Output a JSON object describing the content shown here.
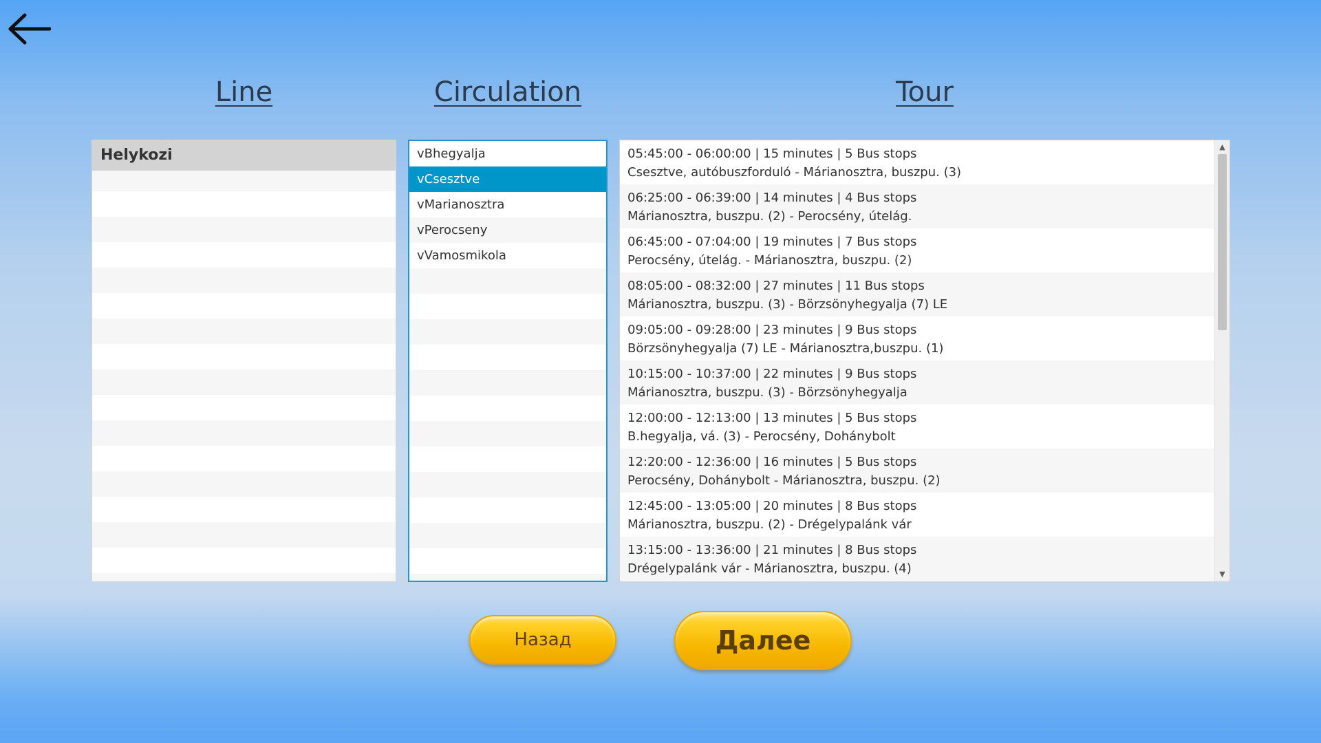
{
  "headers": {
    "line": "Line",
    "circulation": "Circulation",
    "tour": "Tour"
  },
  "lines": [
    "Helykozi"
  ],
  "circulations": [
    "vBhegyalja",
    "vCsesztve",
    "vMarianosztra",
    "vPerocseny",
    "vVamosmikola"
  ],
  "selected_circulation": "vCsesztve",
  "tours": [
    {
      "summary": "05:45:00 - 06:00:00 | 15 minutes | 5 Bus stops",
      "route": "Csesztve, autóbuszforduló - Márianosztra, buszpu. (3)"
    },
    {
      "summary": "06:25:00 - 06:39:00 | 14 minutes | 4 Bus stops",
      "route": "Márianosztra, buszpu. (2) - Perocsény, útelág."
    },
    {
      "summary": "06:45:00 - 07:04:00 | 19 minutes | 7 Bus stops",
      "route": "Perocsény, útelág. - Márianosztra, buszpu. (2)"
    },
    {
      "summary": "08:05:00 - 08:32:00 | 27 minutes | 11 Bus stops",
      "route": "Márianosztra, buszpu. (3) - Börzsönyhegyalja (7) LE"
    },
    {
      "summary": "09:05:00 - 09:28:00 | 23 minutes | 9 Bus stops",
      "route": "Börzsönyhegyalja (7) LE - Márianosztra,buszpu. (1)"
    },
    {
      "summary": "10:15:00 - 10:37:00 | 22 minutes | 9 Bus stops",
      "route": "Márianosztra, buszpu. (3) - Börzsönyhegyalja"
    },
    {
      "summary": "12:00:00 - 12:13:00 | 13 minutes | 5 Bus stops",
      "route": "B.hegyalja, vá. (3) - Perocsény, Dohánybolt"
    },
    {
      "summary": "12:20:00 - 12:36:00 | 16 minutes | 5 Bus stops",
      "route": "Perocsény, Dohánybolt - Márianosztra, buszpu. (2)"
    },
    {
      "summary": "12:45:00 - 13:05:00 | 20 minutes | 8 Bus stops",
      "route": "Márianosztra, buszpu. (2) - Drégelypalánk vár"
    },
    {
      "summary": "13:15:00 - 13:36:00 | 21 minutes | 8 Bus stops",
      "route": "Drégelypalánk vár - Márianosztra, buszpu. (4)"
    }
  ],
  "buttons": {
    "back": "Назад",
    "next": "Далее"
  },
  "icons": {
    "back": "arrow-left-icon",
    "scroll_up": "chevron-up-icon",
    "scroll_down": "chevron-down-icon"
  },
  "colors": {
    "selection": "#0096c9",
    "circulation_border": "#2196d3",
    "button_yellow": "#f7b800"
  }
}
